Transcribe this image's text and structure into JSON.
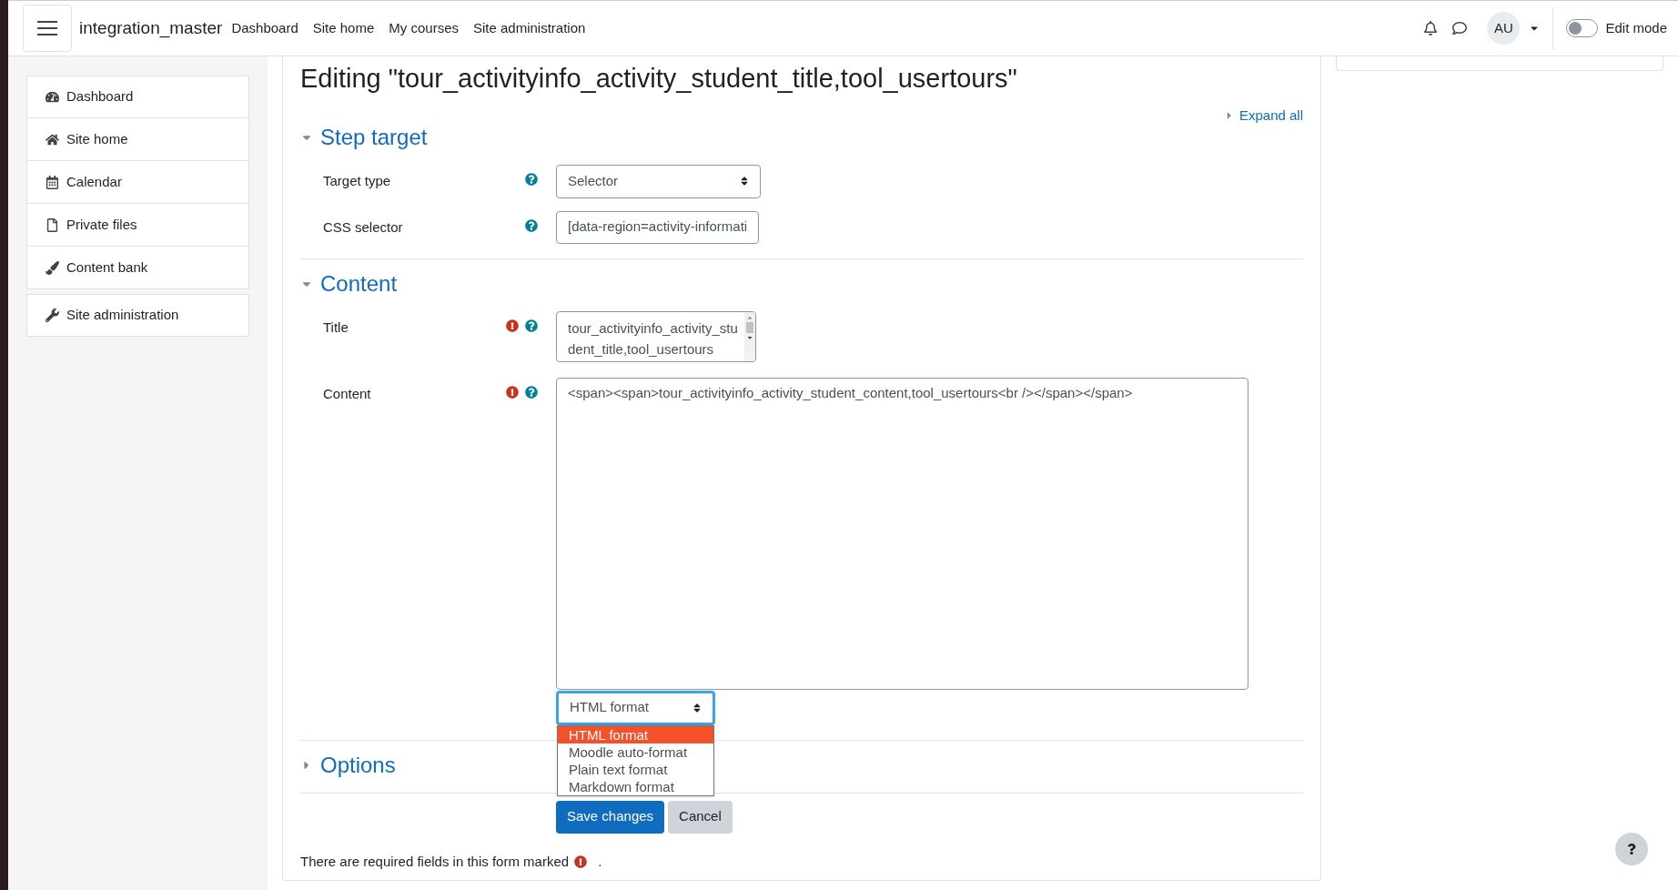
{
  "navbar": {
    "site_name": "integration_master",
    "links": [
      "Dashboard",
      "Site home",
      "My courses",
      "Site administration"
    ],
    "avatar": "AU",
    "edit_mode": {
      "label": "Edit mode",
      "on": false
    }
  },
  "sidebar": {
    "groups": [
      [
        {
          "label": "Dashboard"
        },
        {
          "label": "Site home"
        },
        {
          "label": "Calendar"
        },
        {
          "label": "Private files"
        },
        {
          "label": "Content bank"
        }
      ],
      [
        {
          "label": "Site administration"
        }
      ]
    ]
  },
  "page_title": "Editing \"tour_activityinfo_activity_student_title,tool_usertours\"",
  "expand_all": "Expand all",
  "sections": [
    {
      "title": "Step target",
      "expanded": true,
      "fields": [
        {
          "kind": "select",
          "label": "Target type",
          "required": false,
          "value": "Selector"
        },
        {
          "kind": "text",
          "label": "CSS selector",
          "required": false,
          "value": "[data-region=activity-informati"
        }
      ]
    },
    {
      "title": "Content",
      "expanded": true,
      "fields": [
        {
          "kind": "textarea",
          "label": "Title",
          "required": true,
          "value": "tour_activityinfo_activity_student_title,tool_usertours"
        },
        {
          "kind": "editor",
          "label": "Content",
          "required": true,
          "value": "<span><span>tour_activityinfo_activity_student_content,tool_usertours<br /></span></span>",
          "format": {
            "value": "HTML format",
            "open": true,
            "options": [
              {
                "label": "HTML format",
                "selected": true
              },
              {
                "label": "Moodle auto-format",
                "selected": false
              },
              {
                "label": "Plain text format",
                "selected": false
              },
              {
                "label": "Markdown format",
                "selected": false
              }
            ]
          }
        }
      ]
    },
    {
      "title": "Options",
      "expanded": false
    }
  ],
  "buttons": [
    {
      "kind": "primary",
      "label": "Save changes"
    },
    {
      "kind": "secondary",
      "label": "Cancel"
    }
  ],
  "required_note": {
    "text": "There are required fields in this form marked",
    "end": "."
  }
}
